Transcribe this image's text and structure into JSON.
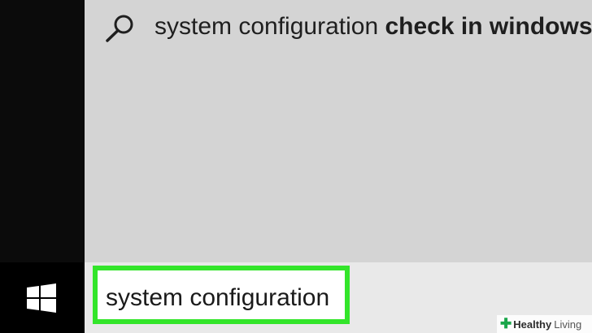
{
  "search_results": {
    "top_suggestion": {
      "icon": "search-icon",
      "prefix": "system configuration ",
      "completion": "check in windows"
    }
  },
  "taskbar": {
    "start_icon": "windows-logo-icon",
    "search": {
      "value": "system configuration",
      "highlight_color": "#33e52a"
    }
  },
  "watermark": {
    "icon": "plus-icon",
    "word1": "Healthy",
    "word2": "Living"
  }
}
